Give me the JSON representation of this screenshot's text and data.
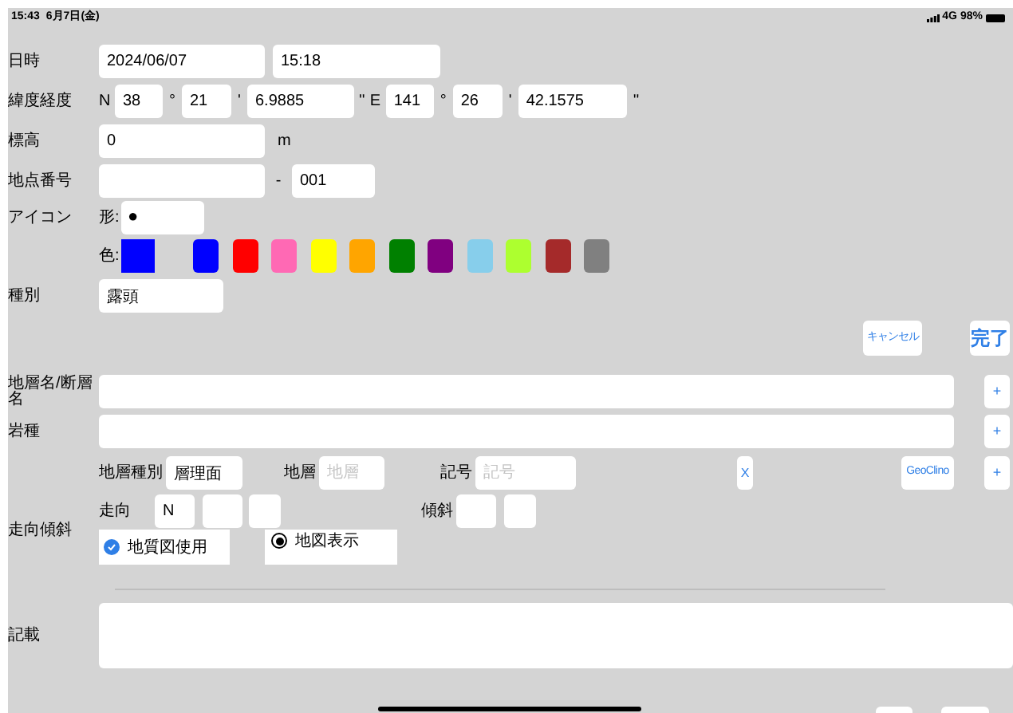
{
  "status_bar": {
    "time": "15:43",
    "date": "6月7日(金)",
    "network": "4G",
    "battery": "98%"
  },
  "datetime": {
    "label": "日時",
    "date": "2024/06/07",
    "time": "15:18"
  },
  "coordinates": {
    "label": "緯度経度",
    "lat_hemisphere": "N",
    "lat_deg": "38",
    "deg_mark_1": "°",
    "lat_min": "21",
    "min_mark_1": "'",
    "lat_sec": "6.9885",
    "sec_mark_1": "''",
    "lon_hemisphere": "E",
    "lon_deg": "141",
    "deg_mark_2": "°",
    "lon_min": "26",
    "min_mark_2": "'",
    "lon_sec": "42.1575",
    "sec_mark_2": "''"
  },
  "elevation": {
    "label": "標高",
    "value": "0",
    "unit": "m"
  },
  "point_number": {
    "label": "地点番号",
    "separator": "-",
    "suffix": "001"
  },
  "icon": {
    "label": "アイコン",
    "shape_label": "形:",
    "shape": "●",
    "color_label": "色:",
    "current": {
      "color": "#0000ff"
    },
    "palette": [
      {
        "color": "#0000ff"
      },
      {
        "color": "#ff0000"
      },
      {
        "color": "#ff69b4"
      },
      {
        "color": "#ffff00"
      },
      {
        "color": "#ffa500"
      },
      {
        "color": "#008000"
      },
      {
        "color": "#800080"
      },
      {
        "color": "#87ceeb"
      },
      {
        "color": "#adff2f"
      },
      {
        "color": "#a52a2a"
      },
      {
        "color": "#808080"
      }
    ]
  },
  "category": {
    "label": "種別",
    "value": "露頭"
  },
  "actions": {
    "cancel": "キャンセル",
    "done": "完了"
  },
  "formation_name": {
    "label": "地層名/断層名",
    "add": "+"
  },
  "rock_type": {
    "label": "岩種",
    "add": "+"
  },
  "strata": {
    "type_label": "地層種別",
    "type_value": "層理面",
    "formation_label": "地層",
    "formation_placeholder": "地層",
    "symbol_label": "記号",
    "symbol_placeholder": "記号",
    "clear": "X",
    "geoclino": "GeoClino",
    "add": "+"
  },
  "strike_dip": {
    "label": "走向傾斜",
    "strike_label": "走向",
    "strike_value": "N",
    "dip_label": "傾斜",
    "geology_map": {
      "label": "地質図使用",
      "checked": true
    },
    "map_display": {
      "label": "地図表示",
      "selected": true
    }
  },
  "description": {
    "label": "記載"
  }
}
